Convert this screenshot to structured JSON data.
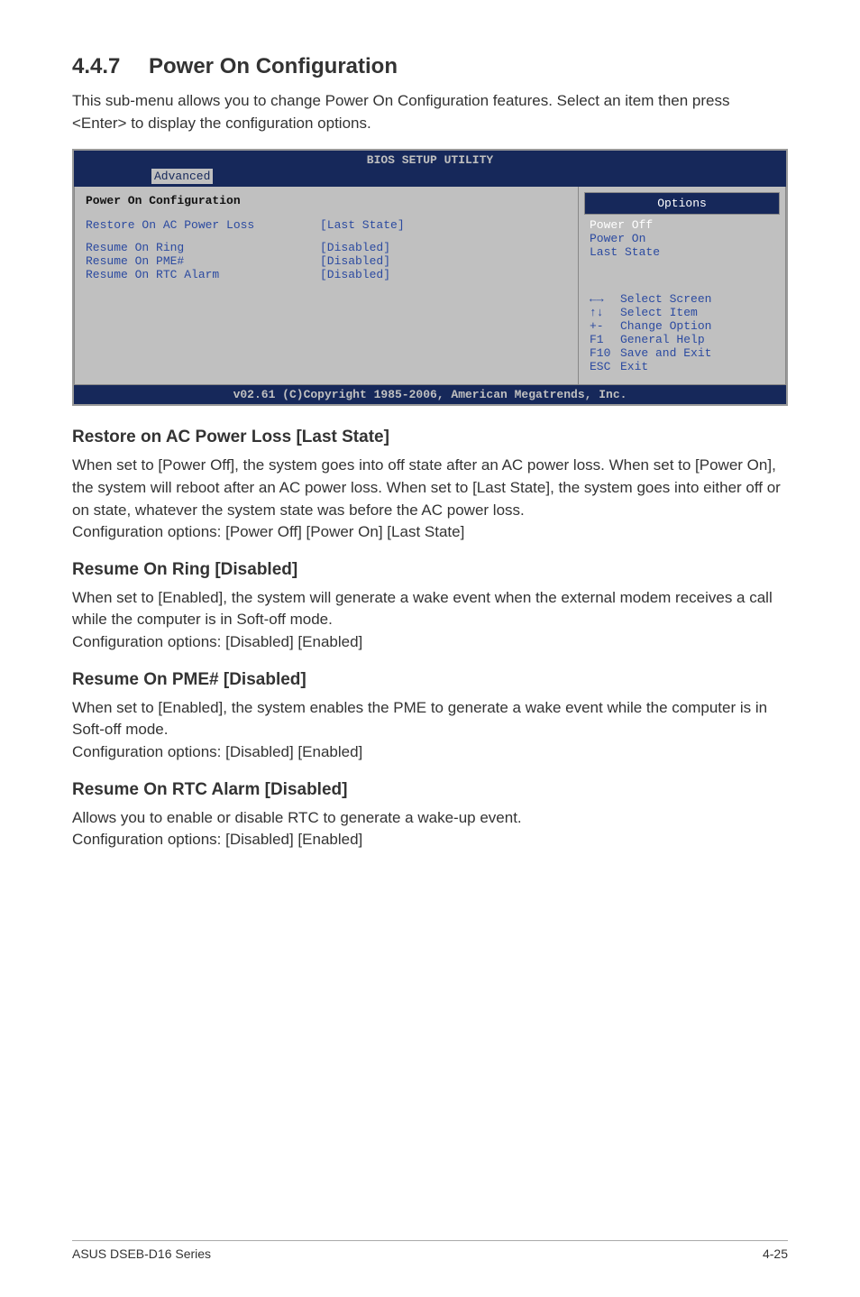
{
  "heading": {
    "number": "4.4.7",
    "title": "Power On Configuration"
  },
  "intro": "This sub-menu allows you to change Power On Configuration features. Select an item then press <Enter> to display the configuration options.",
  "bios": {
    "title": "BIOS SETUP UTILITY",
    "tab": "Advanced",
    "panel_title": "Power On Configuration",
    "rows": [
      {
        "label": "Restore On AC Power Loss",
        "value": "[Last State]"
      },
      {
        "label": "Resume On Ring",
        "value": "[Disabled]"
      },
      {
        "label": "Resume On PME#",
        "value": "[Disabled]"
      },
      {
        "label": "Resume On RTC Alarm",
        "value": "[Disabled]"
      }
    ],
    "options_header": "Options",
    "options": {
      "selected": "Power Off",
      "rest": [
        "Power On",
        "Last State"
      ]
    },
    "help": [
      {
        "key": "←→",
        "desc": "Select Screen"
      },
      {
        "key": "↑↓",
        "desc": "Select Item"
      },
      {
        "key": "+-",
        "desc": "Change Option"
      },
      {
        "key": "F1",
        "desc": "General Help"
      },
      {
        "key": "F10",
        "desc": "Save and Exit"
      },
      {
        "key": "ESC",
        "desc": "Exit"
      }
    ],
    "footer": "v02.61 (C)Copyright 1985-2006, American Megatrends, Inc."
  },
  "sections": [
    {
      "heading": "Restore on AC Power Loss [Last State]",
      "body": "When set to [Power Off], the system goes into off state after an AC power loss. When set to [Power On], the system will reboot after an AC power loss. When set to [Last State], the system goes into either off or on state, whatever the system state was before the AC power loss.\nConfiguration options: [Power Off] [Power On] [Last State]"
    },
    {
      "heading": "Resume On Ring [Disabled]",
      "body": "When set to [Enabled], the system will generate a wake event when the external modem receives a call while the computer is in Soft-off mode.\nConfiguration options: [Disabled] [Enabled]"
    },
    {
      "heading": "Resume On PME# [Disabled]",
      "body": "When set to [Enabled], the system enables the PME to generate a wake event while the computer is in Soft-off mode.\nConfiguration options: [Disabled] [Enabled]"
    },
    {
      "heading": "Resume On RTC Alarm [Disabled]",
      "body": "Allows you to enable or disable RTC to generate a wake-up event.\nConfiguration options: [Disabled] [Enabled]"
    }
  ],
  "footer": {
    "left": "ASUS DSEB-D16 Series",
    "right": "4-25"
  }
}
